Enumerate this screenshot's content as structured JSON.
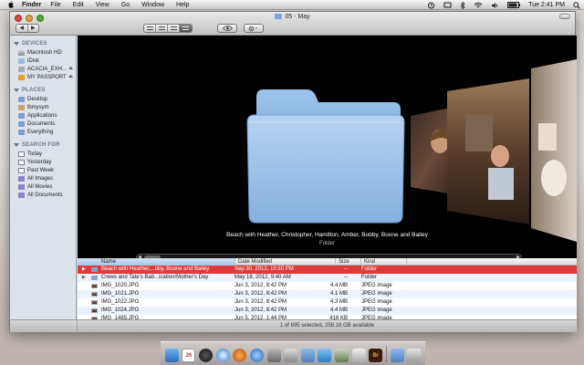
{
  "menubar": {
    "app_name": "Finder",
    "items": [
      "File",
      "Edit",
      "View",
      "Go",
      "Window",
      "Help"
    ],
    "clock": "Tue 2:41 PM"
  },
  "window": {
    "title": "05 - May",
    "back_label": "◀",
    "forward_label": "▶"
  },
  "sidebar": {
    "devices_header": "DEVICES",
    "devices": [
      {
        "label": "Macintosh HD",
        "icon": "hard-disk-icon"
      },
      {
        "label": "iDisk",
        "icon": "idisk-icon"
      },
      {
        "label": "ACACIA_EXH...",
        "icon": "usb-drive-icon",
        "eject": "⏏"
      },
      {
        "label": "MY PASSPORT",
        "icon": "external-drive-icon",
        "eject": "⏏"
      }
    ],
    "places_header": "PLACES",
    "places": [
      {
        "label": "Desktop",
        "icon": "desktop-icon"
      },
      {
        "label": "lbmysym",
        "icon": "home-icon"
      },
      {
        "label": "Applications",
        "icon": "applications-icon"
      },
      {
        "label": "Documents",
        "icon": "documents-icon"
      },
      {
        "label": "Everything",
        "icon": "folder-icon"
      }
    ],
    "search_header": "SEARCH FOR",
    "searches": [
      {
        "label": "Today",
        "icon": "clock-icon"
      },
      {
        "label": "Yesterday",
        "icon": "clock-icon"
      },
      {
        "label": "Past Week",
        "icon": "clock-icon"
      },
      {
        "label": "All Images",
        "icon": "smart-folder-icon"
      },
      {
        "label": "All Movies",
        "icon": "smart-folder-icon"
      },
      {
        "label": "All Documents",
        "icon": "smart-folder-icon"
      }
    ]
  },
  "coverflow": {
    "caption": "Beach with Heather, Christopher, Hamilton, Amber, Bobby, Boone and Bailey",
    "subcaption": "Folder",
    "scroll_left": "◀",
    "scroll_right": "▶"
  },
  "list": {
    "columns": {
      "name": "Name",
      "date": "Date Modified",
      "size": "Size",
      "kind": "Kind"
    },
    "rows": [
      {
        "disc": "▶",
        "name": "Beach with Heather,...bby, Boone and Bailey",
        "date": "Sep 30, 2012, 10:30 PM",
        "size": "--",
        "kind": "Folder",
        "icon": "folder"
      },
      {
        "disc": "▶",
        "name": "Crews and Tate's Bab...ication/Mother's Day",
        "date": "May 18, 2012, 9:40 AM",
        "size": "--",
        "kind": "Folder",
        "icon": "folder"
      },
      {
        "disc": "",
        "name": "IMG_1020.JPG",
        "date": "Jun 3, 2012, 8:42 PM",
        "size": "4.4 MB",
        "kind": "JPEG image",
        "icon": "jpeg"
      },
      {
        "disc": "",
        "name": "IMG_1021.JPG",
        "date": "Jun 3, 2012, 8:42 PM",
        "size": "4.1 MB",
        "kind": "JPEG image",
        "icon": "jpeg"
      },
      {
        "disc": "",
        "name": "IMG_1022.JPG",
        "date": "Jun 3, 2012, 8:42 PM",
        "size": "4.3 MB",
        "kind": "JPEG image",
        "icon": "jpeg"
      },
      {
        "disc": "",
        "name": "IMG_1024.JPG",
        "date": "Jun 3, 2012, 8:42 PM",
        "size": "4.4 MB",
        "kind": "JPEG image",
        "icon": "jpeg"
      },
      {
        "disc": "",
        "name": "IMG_1485.JPG",
        "date": "Jun 5, 2012, 1:44 PM",
        "size": "416 KB",
        "kind": "JPEG image",
        "icon": "jpeg"
      }
    ]
  },
  "status": "1 of 695 selected, 258.16 GB available",
  "colors": {
    "selection": "#e03a3a",
    "sidebar_bg": "#dde3ea",
    "folder_blue": "#7fa7d8"
  },
  "dock": {
    "icons": [
      "finder-icon",
      "calendar-icon",
      "dashboard-icon",
      "safari-icon",
      "firefox-icon",
      "itunes-icon",
      "system-preferences-icon",
      "photo-icon",
      "folder-icon",
      "mail-icon",
      "iphoto-icon",
      "preview-icon",
      "bridge-icon",
      "folder-icon",
      "trash-icon"
    ],
    "calendar_day": "26",
    "bridge_label": "Br"
  }
}
